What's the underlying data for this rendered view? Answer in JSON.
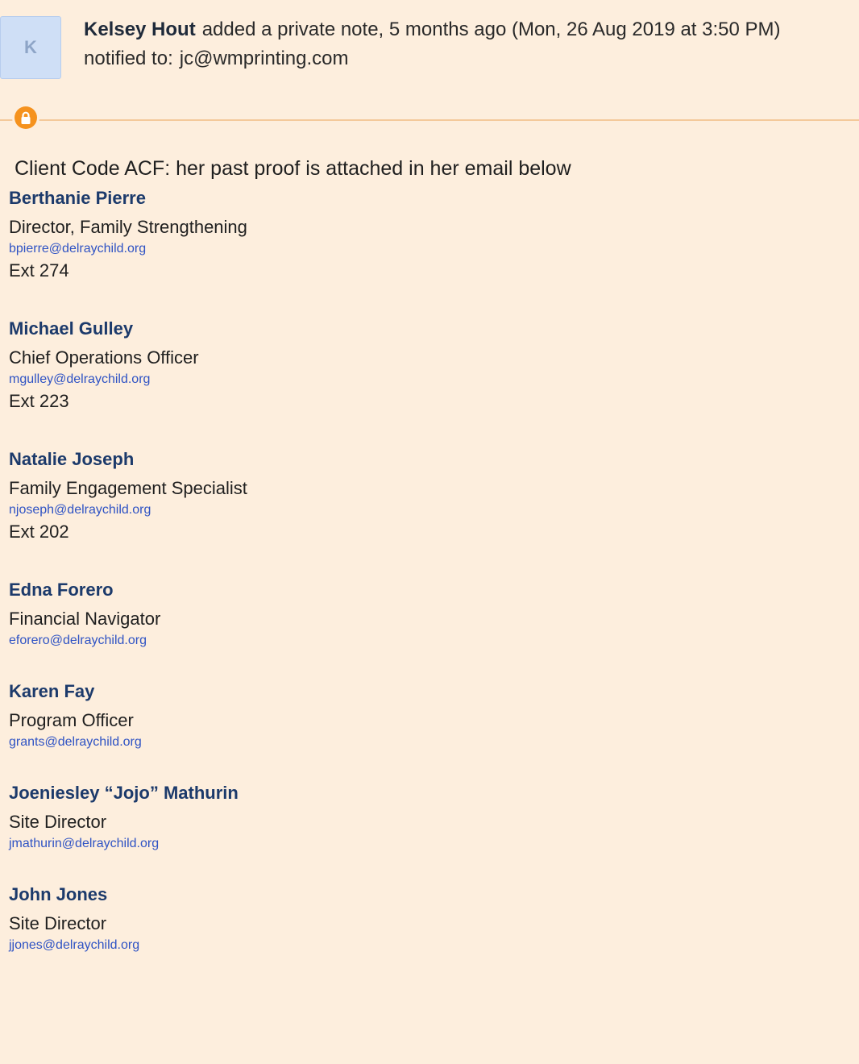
{
  "note": {
    "avatar_initial": "K",
    "author": "Kelsey Hout",
    "action_text": "added a private note, 5 months ago (Mon, 26 Aug 2019 at 3:50 PM)",
    "notified_label": "notified to:",
    "notified_email": "jc@wmprinting.com",
    "privacy_icon": "lock-icon",
    "accent_color": "#f5921e",
    "background_color": "#fdeedd"
  },
  "body": {
    "intro": "Client Code ACF: her past proof is attached in her email below",
    "contacts": [
      {
        "name": "Berthanie Pierre",
        "title": "Director, Family Strengthening",
        "email": "bpierre@delraychild.org",
        "ext": "Ext 274"
      },
      {
        "name": "Michael Gulley",
        "title": "Chief Operations Officer",
        "email": "mgulley@delraychild.org",
        "ext": "Ext 223"
      },
      {
        "name": "Natalie Joseph",
        "title": "Family Engagement Specialist",
        "email": "njoseph@delraychild.org",
        "ext": "Ext 202"
      },
      {
        "name": "Edna Forero",
        "title": "Financial Navigator",
        "email": "eforero@delraychild.org",
        "ext": ""
      },
      {
        "name": "Karen Fay",
        "title": "Program Officer",
        "email": "grants@delraychild.org",
        "ext": ""
      },
      {
        "name": "Joeniesley “Jojo” Mathurin",
        "title": "Site Director",
        "email": "jmathurin@delraychild.org",
        "ext": ""
      },
      {
        "name": "John Jones",
        "title": "Site Director",
        "email": "jjones@delraychild.org",
        "ext": ""
      }
    ]
  }
}
